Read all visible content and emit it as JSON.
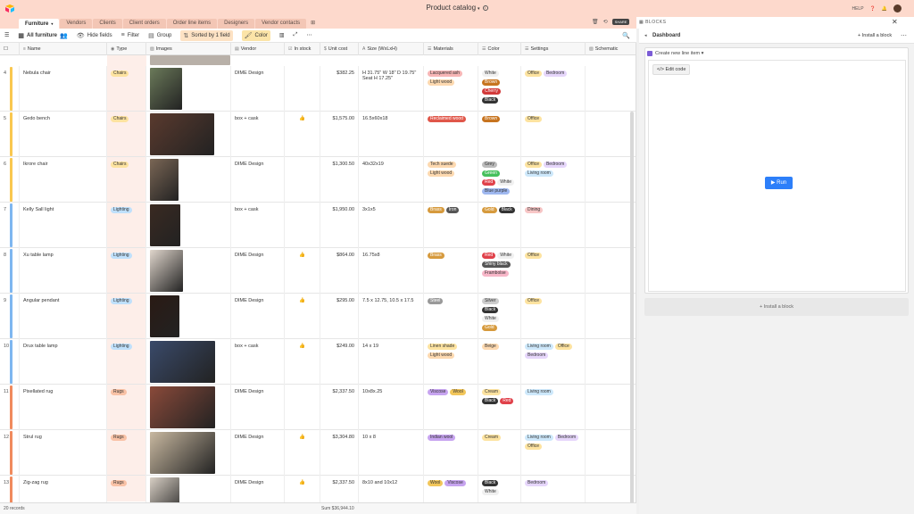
{
  "app": {
    "title": "Product catalog",
    "help": "HELP",
    "share": "SHARE",
    "blocks": "BLOCKS"
  },
  "tabs": [
    {
      "label": "Furniture"
    },
    {
      "label": "Vendors"
    },
    {
      "label": "Clients"
    },
    {
      "label": "Client orders"
    },
    {
      "label": "Order line items"
    },
    {
      "label": "Designers"
    },
    {
      "label": "Vendor contacts"
    }
  ],
  "toolbar": {
    "view": "All furniture",
    "hide_fields": "Hide fields",
    "filter": "Filter",
    "group": "Group",
    "sorted": "Sorted by 1 field",
    "color": "Color"
  },
  "columns": [
    "Name",
    "Type",
    "Images",
    "Vendor",
    "In stock",
    "Unit cost",
    "Size (WxLxH)",
    "Materials",
    "Color",
    "Settings",
    "Schematic"
  ],
  "colors": {
    "Chairs": "#f9c74f",
    "Lighting": "#7eb6f0",
    "Rugs": "#f08a5d",
    "bar_chairs": "#f9c74f",
    "bar_lighting": "#7eb6f0",
    "bar_rugs": "#f08a5d"
  },
  "rows": [
    {
      "num": "4",
      "name": "Nebula chair",
      "type": "Chairs",
      "vendor": "DIME Design",
      "stock": "",
      "cost": "$382.25",
      "size": "H 31.75\" W 18\" D 19.75\" Seat H 17.25\"",
      "materials": [
        "Lacquered ash",
        "Light wood"
      ],
      "color": [
        "White",
        "Brown",
        "Cherry",
        "Black"
      ],
      "settings": [
        "Office",
        "Bedroom"
      ],
      "img": "#6b7a5a"
    },
    {
      "num": "5",
      "name": "Gedo bench",
      "type": "Chairs",
      "vendor": "box + cask",
      "stock": "👍",
      "cost": "$1,575.00",
      "size": "16.5x60x18",
      "materials": [
        "Reclaimed wood"
      ],
      "color": [
        "Brown"
      ],
      "settings": [
        "Office"
      ],
      "img": "#5a3a2e"
    },
    {
      "num": "6",
      "name": "Ikrore chair",
      "type": "Chairs",
      "vendor": "DIME Design",
      "stock": "",
      "cost": "$1,300.50",
      "size": "40x32x19",
      "materials": [
        "Tech suede",
        "Light wood"
      ],
      "color": [
        "Grey",
        "Green",
        "Red",
        "White",
        "Blue purple"
      ],
      "settings": [
        "Office",
        "Bedroom",
        "Living room"
      ],
      "img": "#7a6655"
    },
    {
      "num": "7",
      "name": "Kelly Sall light",
      "type": "Lighting",
      "vendor": "box + cask",
      "stock": "",
      "cost": "$1,950.00",
      "size": "3x1x5",
      "materials": [
        "Brass",
        "Iron"
      ],
      "color": [
        "Gold",
        "Black"
      ],
      "settings": [
        "Dining"
      ],
      "img": "#3a2a22"
    },
    {
      "num": "8",
      "name": "Xu table lamp",
      "type": "Lighting",
      "vendor": "DIME Design",
      "stock": "👍",
      "cost": "$864.00",
      "size": "16.75x8",
      "materials": [
        "Brass"
      ],
      "color": [
        "Red",
        "White",
        "Shiny black",
        "Frambolse"
      ],
      "settings": [
        "Office"
      ],
      "img": "#e0d6cc"
    },
    {
      "num": "9",
      "name": "Angular pendant",
      "type": "Lighting",
      "vendor": "DIME Design",
      "stock": "👍",
      "cost": "$295.00",
      "size": "7.5 x 12.75, 10.5 x 17.5",
      "materials": [
        "Steel"
      ],
      "color": [
        "Silver",
        "Black",
        "White",
        "Gold"
      ],
      "settings": [
        "Office"
      ],
      "img": "#2a1a14"
    },
    {
      "num": "10",
      "name": "Drux table lamp",
      "type": "Lighting",
      "vendor": "box + cask",
      "stock": "👍",
      "cost": "$249.00",
      "size": "14 x 19",
      "materials": [
        "Linen shade",
        "Light wood"
      ],
      "color": [
        "Beige"
      ],
      "settings": [
        "Living room",
        "Office",
        "Bedroom"
      ],
      "img": "#3a4a6a"
    },
    {
      "num": "11",
      "name": "Pixellated rug",
      "type": "Rugs",
      "vendor": "DIME Design",
      "stock": "",
      "cost": "$2,337.50",
      "size": "10x8x.25",
      "materials": [
        "Viscose",
        "Wool"
      ],
      "color": [
        "Cream",
        "Black",
        "Red"
      ],
      "settings": [
        "Living room"
      ],
      "img": "#8a4a3a"
    },
    {
      "num": "12",
      "name": "Strul rug",
      "type": "Rugs",
      "vendor": "DIME Design",
      "stock": "👍",
      "cost": "$3,304.80",
      "size": "10 x 8",
      "materials": [
        "Indian wool"
      ],
      "color": [
        "Cream"
      ],
      "settings": [
        "Living room",
        "Bedroom",
        "Office"
      ],
      "img": "#c8b8a0"
    },
    {
      "num": "13",
      "name": "Zig-zag rug",
      "type": "Rugs",
      "vendor": "DIME Design",
      "stock": "👍",
      "cost": "$2,337.50",
      "size": "8x10 and 10x12",
      "materials": [
        "Wool",
        "Viscose"
      ],
      "color": [
        "Black",
        "White"
      ],
      "settings": [
        "Bedroom"
      ],
      "img": "#d8cfc4"
    }
  ],
  "footer": {
    "records": "20 records",
    "sum": "Sum $36,944.10"
  },
  "dashboard": {
    "title": "Dashboard",
    "install": "Install a block",
    "block_title": "Create new line item",
    "edit_code": "Edit code",
    "run": "Run",
    "install_bottom": "Install a block"
  }
}
